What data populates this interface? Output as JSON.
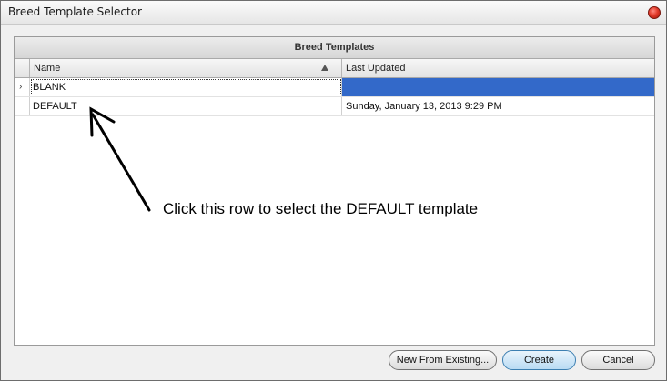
{
  "window": {
    "title": "Breed Template Selector"
  },
  "grid": {
    "title": "Breed Templates",
    "columns": [
      {
        "label": "Name",
        "sort": "ascending"
      },
      {
        "label": "Last Updated"
      }
    ],
    "rows": [
      {
        "name": "BLANK",
        "last_updated": "",
        "selected": true
      },
      {
        "name": "DEFAULT",
        "last_updated": "Sunday, January 13, 2013 9:29 PM",
        "selected": false
      }
    ]
  },
  "annotation": {
    "text": "Click this row to select the DEFAULT template"
  },
  "buttons": {
    "new_from_existing": "New From Existing...",
    "create": "Create",
    "cancel": "Cancel"
  },
  "colors": {
    "selection": "#3369c9",
    "close_button": "#e23b2b",
    "primary_button": "#b9dbf3"
  },
  "icons": {
    "close": "close-icon",
    "row_indicator": "chevron-right-icon",
    "sort": "sort-ascending-icon"
  }
}
